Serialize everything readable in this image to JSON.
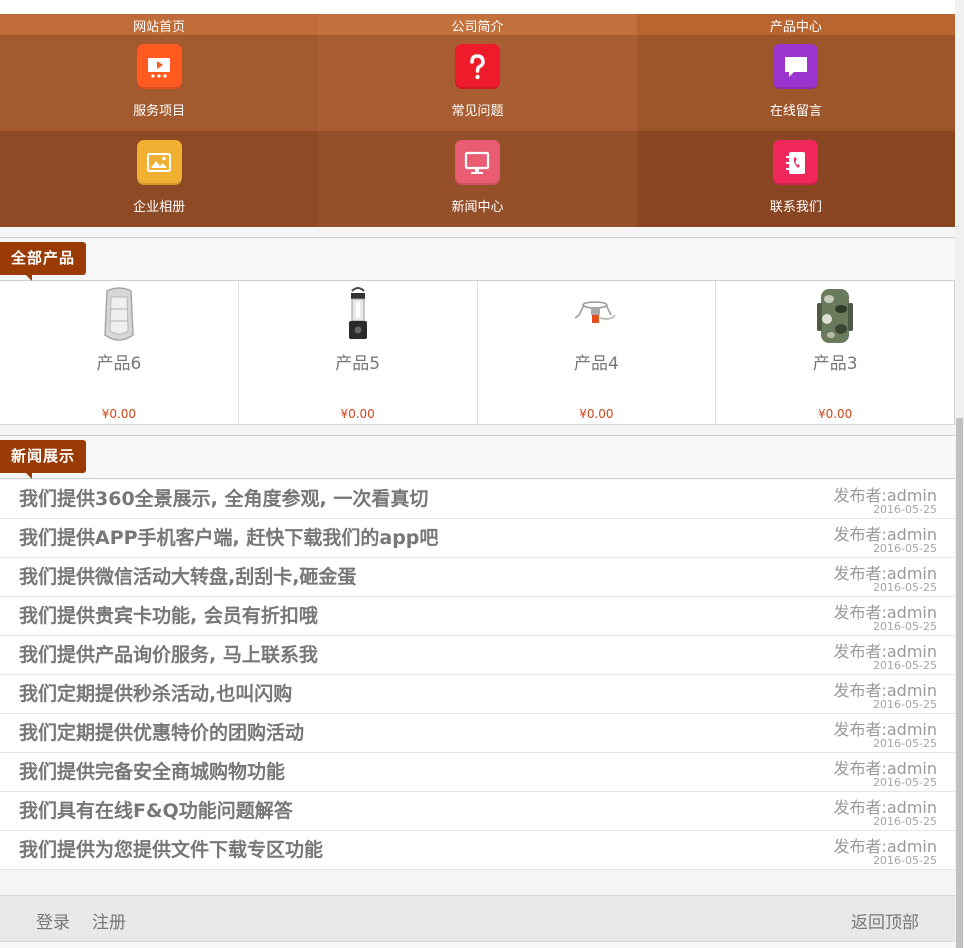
{
  "nav": {
    "row0": [
      {
        "label": "网站首页",
        "bg": "#bf6c38"
      },
      {
        "label": "公司简介",
        "bg": "#c2703c"
      },
      {
        "label": "产品中心",
        "bg": "#b9652f"
      }
    ],
    "row1": [
      {
        "label": "服务项目",
        "icon": "presentation-icon",
        "bg": "#a25a2e",
        "icon_color": "#ff5a1f"
      },
      {
        "label": "常见问题",
        "icon": "question-icon",
        "bg": "#a85e32",
        "icon_color": "#ee1c2a"
      },
      {
        "label": "在线留言",
        "icon": "chat-bubble-icon",
        "bg": "#9d552a",
        "icon_color": "#9c35d0"
      }
    ],
    "row2": [
      {
        "label": "企业相册",
        "icon": "photo-album-icon",
        "bg": "#8e4a24",
        "icon_color": "#f0b132"
      },
      {
        "label": "新闻中心",
        "icon": "monitor-icon",
        "bg": "#95502a",
        "icon_color": "#ea5c72"
      },
      {
        "label": "联系我们",
        "icon": "phone-book-icon",
        "bg": "#8a4622",
        "icon_color": "#f0275a"
      }
    ]
  },
  "products_section": {
    "title": "全部产品"
  },
  "products": [
    {
      "name": "产品6",
      "price": "¥0.00",
      "icon": "inflatable-boat-icon"
    },
    {
      "name": "产品5",
      "price": "¥0.00",
      "icon": "camping-lantern-icon"
    },
    {
      "name": "产品4",
      "price": "¥0.00",
      "icon": "camping-stove-icon"
    },
    {
      "name": "产品3",
      "price": "¥0.00",
      "icon": "camo-backpack-icon"
    }
  ],
  "news_section": {
    "title": "新闻展示"
  },
  "news": [
    {
      "title": "我们提供360全景展示, 全角度参观, 一次看真切",
      "author": "发布者:admin",
      "date": "2016-05-25"
    },
    {
      "title": "我们提供APP手机客户端, 赶快下载我们的app吧",
      "author": "发布者:admin",
      "date": "2016-05-25"
    },
    {
      "title": "我们提供微信活动大转盘,刮刮卡,砸金蛋",
      "author": "发布者:admin",
      "date": "2016-05-25"
    },
    {
      "title": "我们提供贵宾卡功能, 会员有折扣哦",
      "author": "发布者:admin",
      "date": "2016-05-25"
    },
    {
      "title": "我们提供产品询价服务, 马上联系我",
      "author": "发布者:admin",
      "date": "2016-05-25"
    },
    {
      "title": "我们定期提供秒杀活动,也叫闪购",
      "author": "发布者:admin",
      "date": "2016-05-25"
    },
    {
      "title": "我们定期提供优惠特价的团购活动",
      "author": "发布者:admin",
      "date": "2016-05-25"
    },
    {
      "title": "我们提供完备安全商城购物功能",
      "author": "发布者:admin",
      "date": "2016-05-25"
    },
    {
      "title": "我们具有在线F&Q功能问题解答",
      "author": "发布者:admin",
      "date": "2016-05-25"
    },
    {
      "title": "我们提供为您提供文件下载专区功能",
      "author": "发布者:admin",
      "date": "2016-05-25"
    }
  ],
  "footer": {
    "login": "登录",
    "register": "注册",
    "back_top": "返回顶部"
  }
}
